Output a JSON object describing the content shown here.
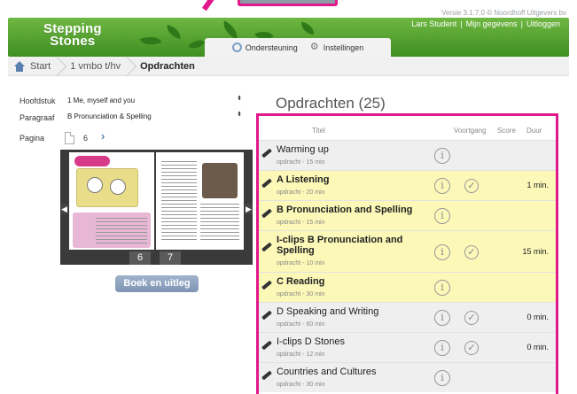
{
  "version_text": "Versie 3.1.7.0 © Noordhoff Uitgevers bv",
  "header": {
    "logo_line1": "Stepping",
    "logo_line2": "Stones",
    "user_links": [
      "Lars Student",
      "|",
      "Mijn gegevens",
      "|",
      "Uitloggen"
    ],
    "subtabs": [
      {
        "label": "Ondersteuning",
        "icon": "lifebuoy-icon"
      },
      {
        "label": "Instellingen",
        "icon": "gear-icon"
      }
    ],
    "brand_color": "#4f9f2e"
  },
  "breadcrumb": [
    "Start",
    "1 vmbo t/hv",
    "Opdrachten"
  ],
  "form": {
    "hoofdstuk_label": "Hoofdstuk",
    "hoofdstuk_value": "1 Me, myself and you",
    "paragraaf_label": "Paragraaf",
    "paragraaf_value": "B Pronunciation & Spelling",
    "pagina_label": "Pagina",
    "pagina_value": "6"
  },
  "preview": {
    "page_left": "6",
    "page_right": "7",
    "left_tile_title": "Making friends"
  },
  "boek_button": "Boek en uitleg",
  "opdrachten": {
    "title": "Opdrachten (25)",
    "columns": {
      "titel": "Titel",
      "voortgang": "Voortgang",
      "score": "Score",
      "duur": "Duur"
    },
    "rows": [
      {
        "title": "Warming up",
        "sub": "opdracht - 15 min",
        "bold": false,
        "highlight": false,
        "check": false,
        "duur": ""
      },
      {
        "title": "A Listening",
        "sub": "opdracht - 20 min",
        "bold": true,
        "highlight": true,
        "check": true,
        "duur": "1 min."
      },
      {
        "title": "B Pronunciation and Spelling",
        "sub": "opdracht - 15 min",
        "bold": true,
        "highlight": true,
        "check": false,
        "duur": ""
      },
      {
        "title": "I-clips B Pronunciation and Spelling",
        "sub": "opdracht - 10 min",
        "bold": true,
        "highlight": true,
        "check": true,
        "duur": "15 min."
      },
      {
        "title": "C Reading",
        "sub": "opdracht - 30 min",
        "bold": true,
        "highlight": true,
        "check": false,
        "duur": ""
      },
      {
        "title": "D Speaking and Writing",
        "sub": "opdracht - 60 min",
        "bold": false,
        "highlight": false,
        "check": true,
        "duur": "0 min."
      },
      {
        "title": "I-clips D Stones",
        "sub": "opdracht - 12 min",
        "bold": false,
        "highlight": false,
        "check": true,
        "duur": "0 min."
      },
      {
        "title": "Countries and Cultures",
        "sub": "opdracht - 30 min",
        "bold": false,
        "highlight": false,
        "check": false,
        "duur": ""
      }
    ]
  },
  "colors": {
    "highlight_row": "#fbf8b8",
    "annotation_pink": "#e0188a"
  }
}
